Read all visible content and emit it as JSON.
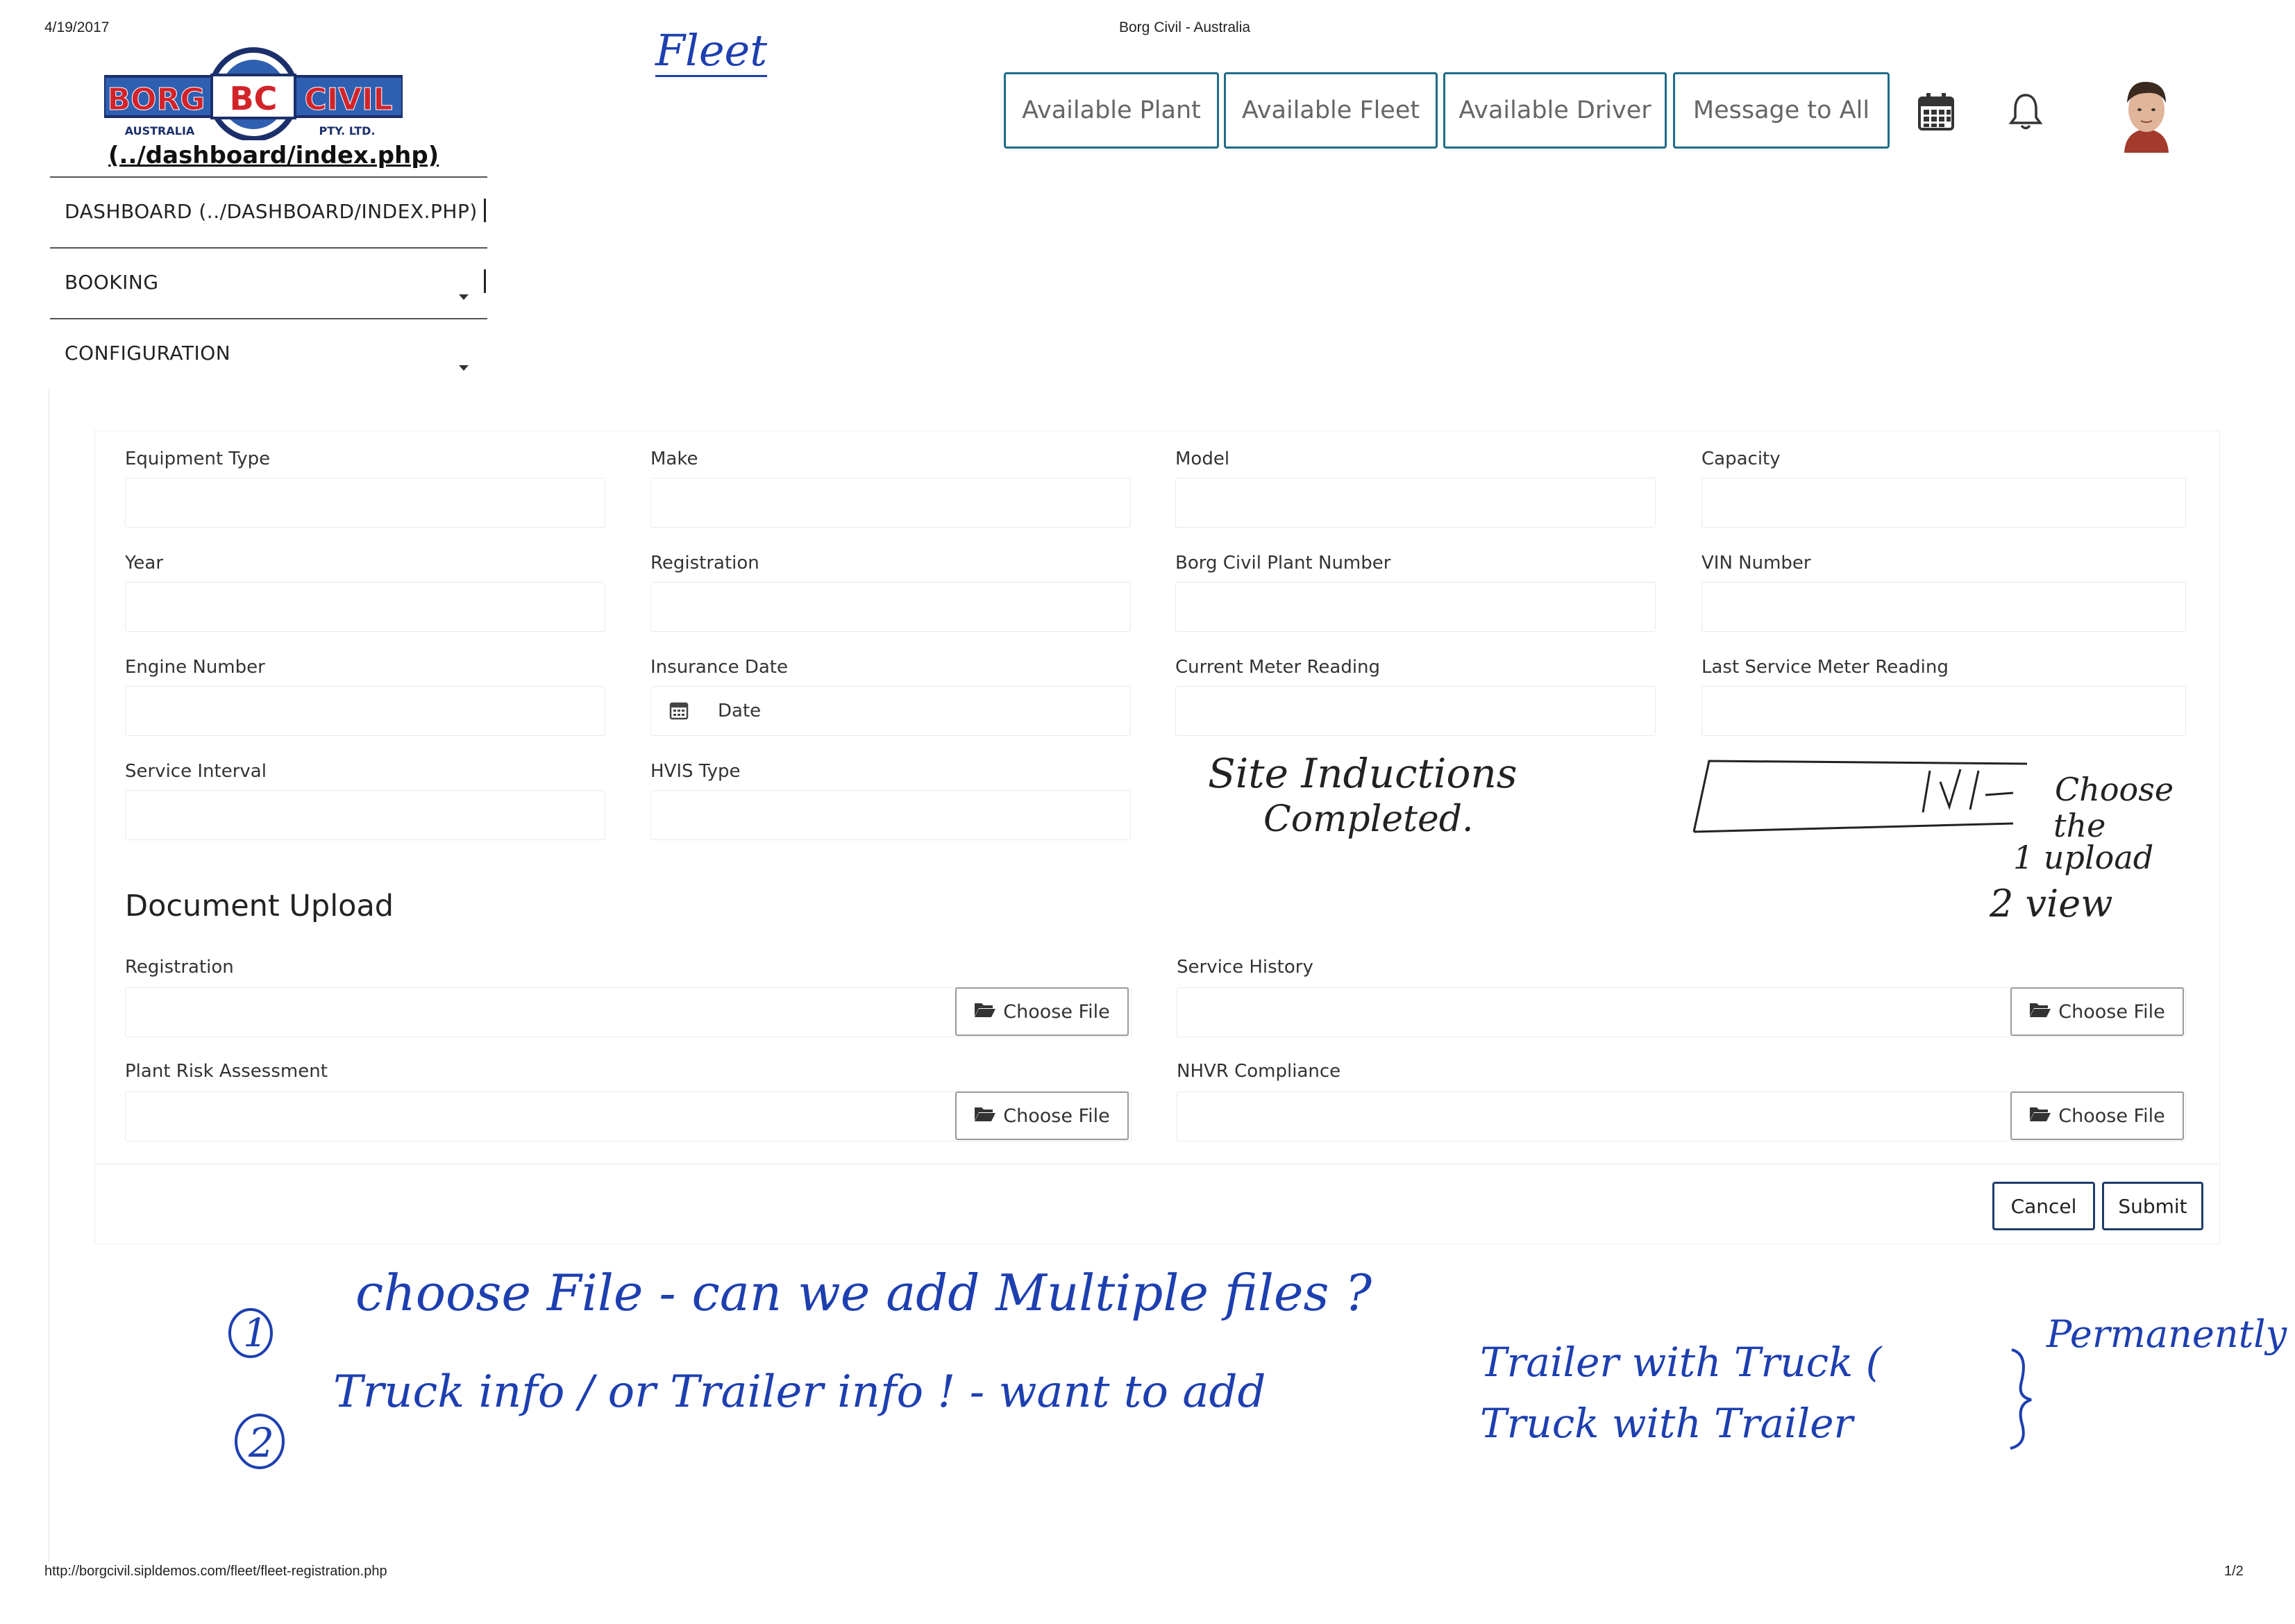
{
  "print_header": {
    "date": "4/19/2017",
    "title": "Borg Civil - Australia"
  },
  "logo": {
    "word_left": "BORG",
    "monogram": "BC",
    "word_right": "CIVIL",
    "sub_left": "AUSTRALIA",
    "sub_right": "PTY. LTD.",
    "link": "(../dashboard/index.php)",
    "colors": {
      "blue": "#2f5fb0",
      "red": "#d2232a",
      "navy": "#1b2f6b"
    }
  },
  "sidebar": {
    "items": [
      {
        "label": "DASHBOARD (../DASHBOARD/INDEX.PHP)"
      },
      {
        "label": "BOOKING"
      },
      {
        "label": "CONFIGURATION"
      }
    ]
  },
  "top_buttons": [
    "Available Plant",
    "Available Fleet",
    "Available Driver",
    "Message to All"
  ],
  "form": {
    "fields": [
      {
        "label": "Equipment Type",
        "value": ""
      },
      {
        "label": "Make",
        "value": ""
      },
      {
        "label": "Model",
        "value": ""
      },
      {
        "label": "Capacity",
        "value": ""
      },
      {
        "label": "Year",
        "value": ""
      },
      {
        "label": "Registration",
        "value": ""
      },
      {
        "label": "Borg Civil Plant Number",
        "value": ""
      },
      {
        "label": "VIN Number",
        "value": ""
      },
      {
        "label": "Engine Number",
        "value": ""
      },
      {
        "label": "Insurance Date",
        "placeholder": "Date"
      },
      {
        "label": "Current Meter Reading",
        "value": ""
      },
      {
        "label": "Last Service Meter Reading",
        "value": ""
      },
      {
        "label": "Service Interval",
        "value": ""
      },
      {
        "label": "HVIS Type",
        "value": ""
      }
    ],
    "document_upload": {
      "title": "Document Upload",
      "items": [
        {
          "label": "Registration",
          "button": "Choose File"
        },
        {
          "label": "Service History",
          "button": "Choose File"
        },
        {
          "label": "Plant Risk Assessment",
          "button": "Choose File"
        },
        {
          "label": "NHVR Compliance",
          "button": "Choose File"
        }
      ]
    },
    "actions": {
      "cancel": "Cancel",
      "submit": "Submit"
    }
  },
  "handwriting": {
    "fleet": "Fleet",
    "site_inductions": [
      "Site Inductions",
      "Completed."
    ],
    "choose_note": [
      "Choose",
      "the",
      "1 upload",
      "2 view"
    ],
    "note1": [
      "1",
      "choose File - can we add Multiple files ?"
    ],
    "note2": [
      "2",
      "Truck info / or Trailer info ! - want to add"
    ],
    "note2b": [
      "Trailer with Truck (",
      "Truck with Trailer",
      "Permanently"
    ]
  },
  "footer": {
    "url": "http://borgcivil.sipldemos.com/fleet/fleet-registration.php",
    "page": "1/2"
  }
}
